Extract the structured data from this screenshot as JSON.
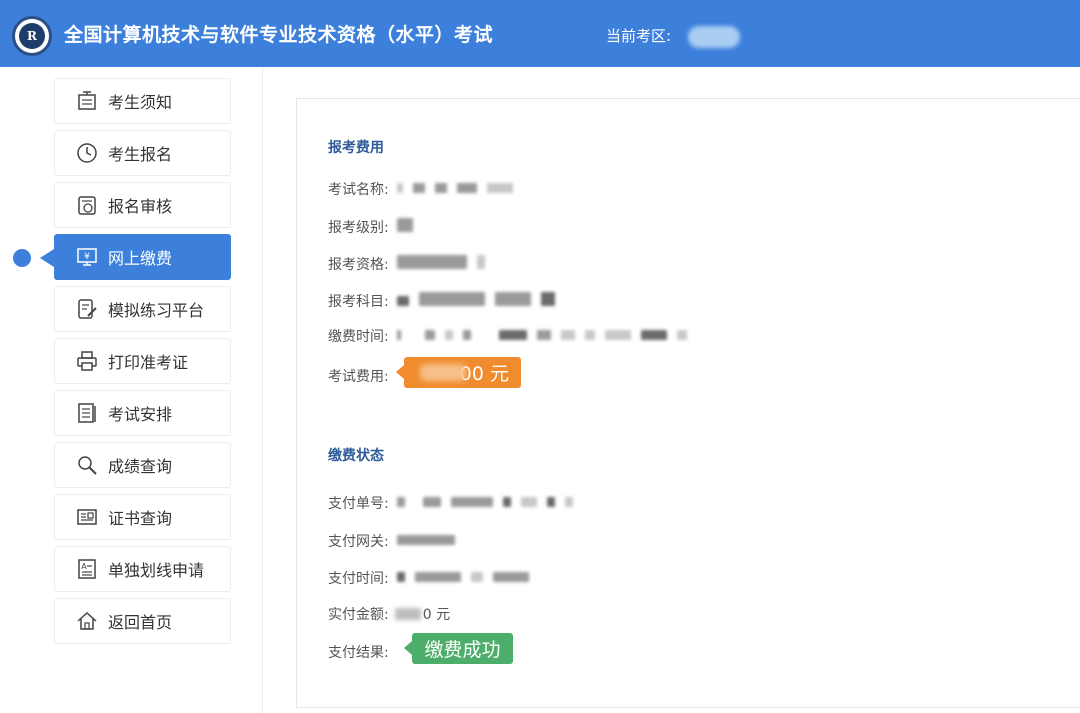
{
  "header": {
    "title": "全国计算机技术与软件专业技术资格（水平）考试",
    "region_label": "当前考区:",
    "logo_text": "R"
  },
  "sidebar": {
    "items": [
      {
        "label": "考生须知",
        "icon": "notice-board-icon"
      },
      {
        "label": "考生报名",
        "icon": "clock-icon"
      },
      {
        "label": "报名审核",
        "icon": "review-icon"
      },
      {
        "label": "网上缴费",
        "icon": "monitor-yen-icon",
        "active": true
      },
      {
        "label": "模拟练习平台",
        "icon": "pencil-document-icon"
      },
      {
        "label": "打印准考证",
        "icon": "printer-icon"
      },
      {
        "label": "考试安排",
        "icon": "document-list-icon"
      },
      {
        "label": "成绩查询",
        "icon": "magnifier-icon"
      },
      {
        "label": "证书查询",
        "icon": "certificate-icon"
      },
      {
        "label": "单独划线申请",
        "icon": "application-form-icon"
      },
      {
        "label": "返回首页",
        "icon": "home-icon"
      }
    ]
  },
  "fees": {
    "section_title": "报考费用",
    "exam_name_label": "考试名称:",
    "level_label": "报考级别:",
    "qualification_label": "报考资格:",
    "subject_label": "报考科目:",
    "payment_time_label": "缴费时间:",
    "fee_label": "考试费用:",
    "fee_value": "00 元"
  },
  "payment": {
    "section_title": "缴费状态",
    "order_no_label": "支付单号:",
    "gateway_label": "支付网关:",
    "time_label": "支付时间:",
    "amount_label": "实付金额:",
    "amount_value": "0 元",
    "result_label": "支付结果:",
    "result_value": "缴费成功"
  },
  "colors": {
    "primary": "#3d80dc",
    "fee_tag": "#f08c2e",
    "success_tag": "#4cae6a",
    "section_title": "#2f5c99"
  }
}
